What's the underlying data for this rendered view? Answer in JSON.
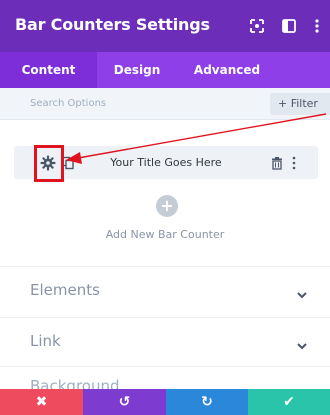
{
  "header": {
    "title": "Bar Counters Settings"
  },
  "tabs": [
    {
      "label": "Content"
    },
    {
      "label": "Design"
    },
    {
      "label": "Advanced"
    }
  ],
  "search": {
    "placeholder": "Search Options",
    "filter_label": "+ Filter"
  },
  "item": {
    "title": "Your Title Goes Here"
  },
  "add": {
    "label": "Add New Bar Counter",
    "plus": "+"
  },
  "sections": [
    {
      "label": "Elements"
    },
    {
      "label": "Link"
    }
  ],
  "partial_section": {
    "label": "Background"
  },
  "footer": {
    "cancel_glyph": "✖",
    "undo_glyph": "↺",
    "redo_glyph": "↻",
    "save_glyph": "✔"
  },
  "colors": {
    "header": "#6c2eb9",
    "tabs": "#8e3fe8",
    "cancel": "#ef4b5f",
    "undo": "#7e3bd0",
    "redo": "#2b87da",
    "save": "#29c4a9",
    "highlight": "#e0141e"
  }
}
